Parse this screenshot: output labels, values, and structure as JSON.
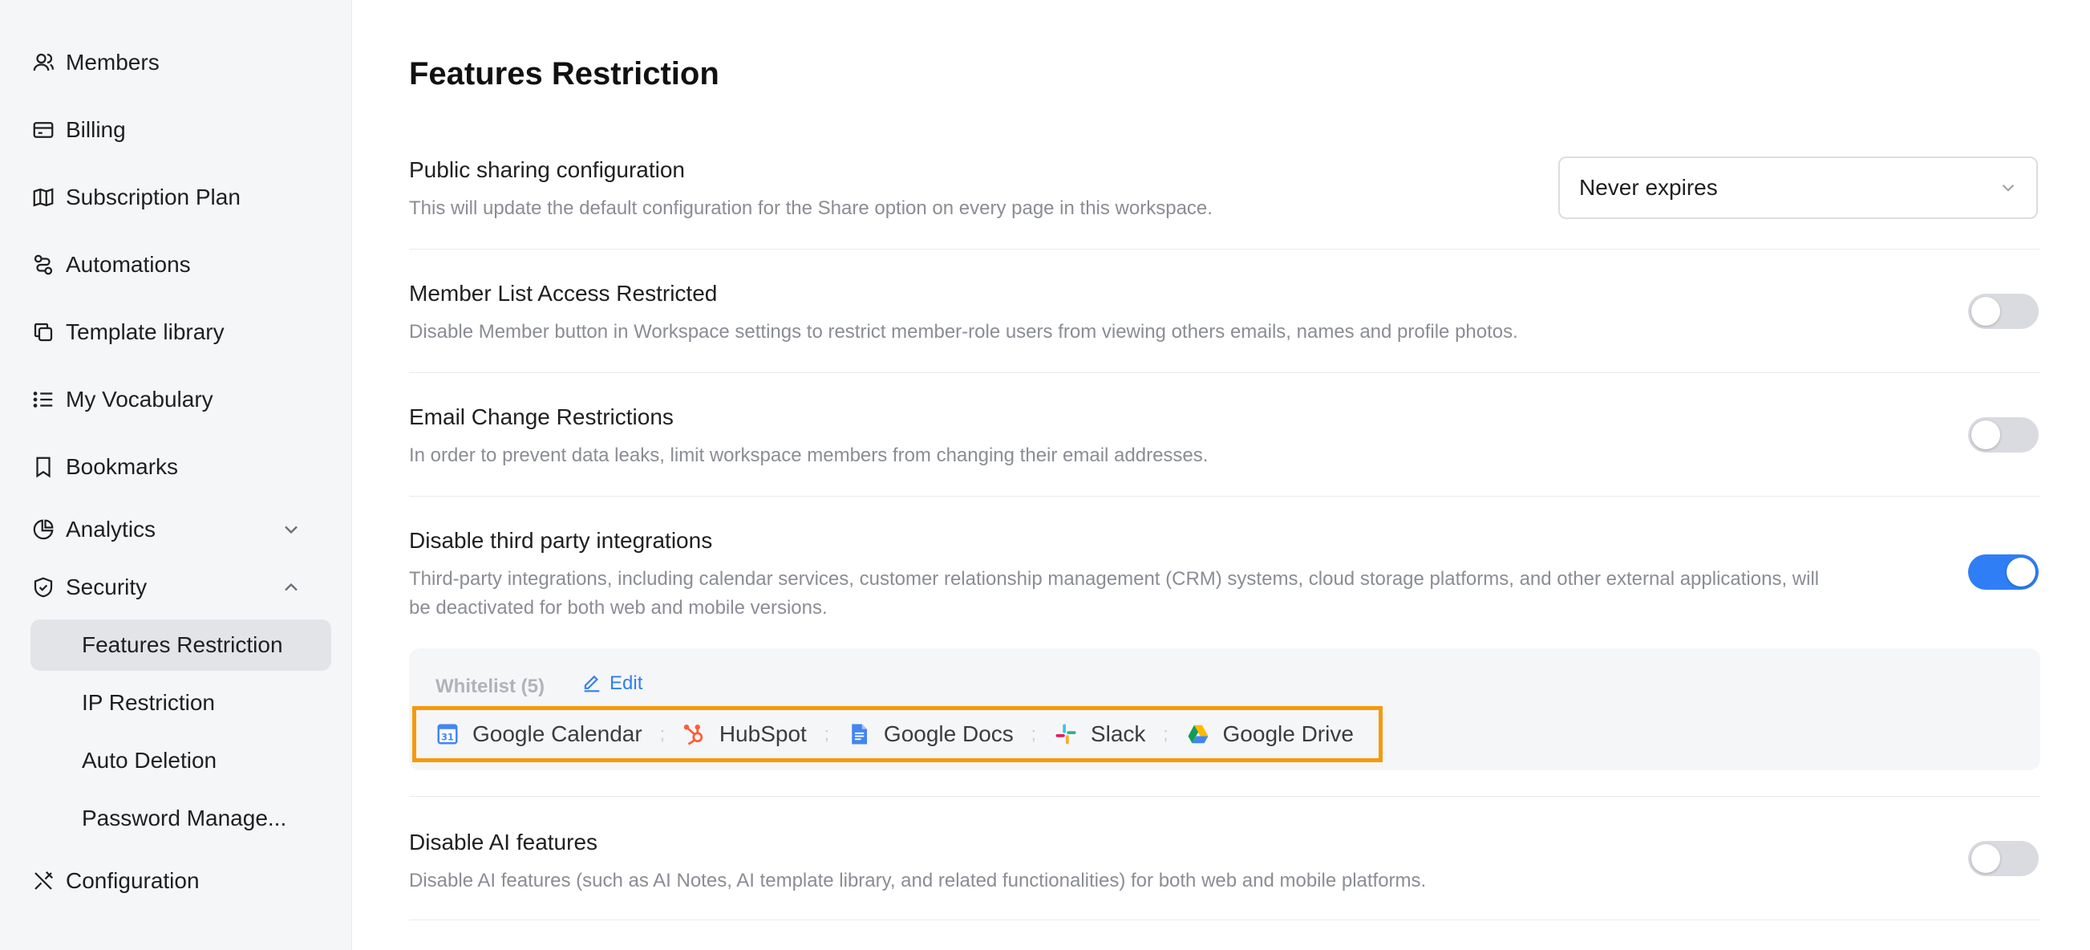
{
  "sidebar": {
    "items": [
      {
        "label": "Members",
        "icon": "members-icon"
      },
      {
        "label": "Billing",
        "icon": "billing-icon"
      },
      {
        "label": "Subscription Plan",
        "icon": "map-icon"
      },
      {
        "label": "Automations",
        "icon": "automations-icon"
      },
      {
        "label": "Template library",
        "icon": "template-icon"
      },
      {
        "label": "My Vocabulary",
        "icon": "list-icon"
      },
      {
        "label": "Bookmarks",
        "icon": "bookmark-icon"
      },
      {
        "label": "Analytics",
        "icon": "pie-chart-icon"
      },
      {
        "label": "Security",
        "icon": "shield-icon"
      },
      {
        "label": "Configuration",
        "icon": "tools-icon"
      }
    ],
    "security_sub": [
      "Features Restriction",
      "IP Restriction",
      "Auto Deletion",
      "Password Manage..."
    ]
  },
  "main": {
    "title": "Features Restriction",
    "public_sharing": {
      "title": "Public sharing configuration",
      "desc": "This will update the default configuration for the Share option on every page in this workspace.",
      "value": "Never expires"
    },
    "member_list": {
      "title": "Member List Access Restricted",
      "desc": "Disable Member button in Workspace settings to restrict member-role users from viewing others emails, names and profile photos.",
      "enabled": false
    },
    "email_change": {
      "title": "Email Change Restrictions",
      "desc": "In order to prevent data leaks, limit workspace members from changing their email addresses.",
      "enabled": false
    },
    "third_party": {
      "title": "Disable third party integrations",
      "desc_line1": "Third-party integrations, including calendar services, customer relationship management (CRM) systems, cloud storage platforms, and other external applications, will",
      "desc_line2": "be deactivated for both web and mobile versions.",
      "enabled": true,
      "whitelist_label": "Whitelist (5)",
      "edit_label": "Edit",
      "apps": [
        "Google Calendar",
        "HubSpot",
        "Google Docs",
        "Slack",
        "Google Drive"
      ],
      "separator": ";"
    },
    "ai_features": {
      "title": "Disable AI features",
      "desc": "Disable AI features (such as AI Notes, AI template library, and related functionalities) for both web and mobile platforms.",
      "enabled": false
    }
  },
  "colors": {
    "accent": "#2f7ef5",
    "highlight": "#f59a0c",
    "sidebar_bg": "#f5f6f8"
  }
}
